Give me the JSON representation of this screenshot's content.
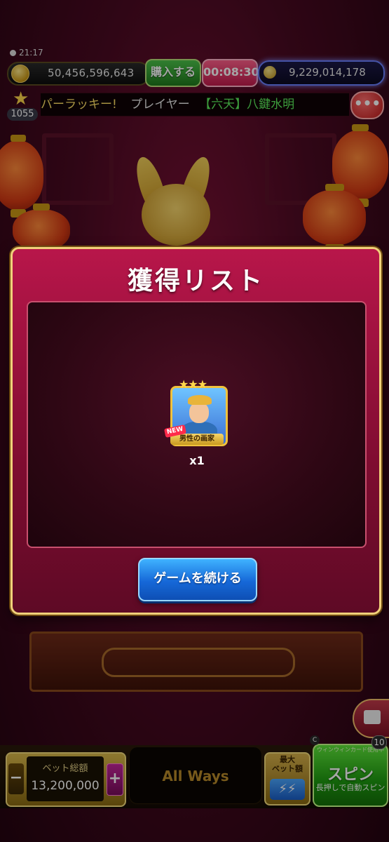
{
  "status": {
    "time": "21:17"
  },
  "hud": {
    "coins": "50,456,596,643",
    "buy_label": "購入する",
    "timer": "00:08:30",
    "gems": "9,229,014,178"
  },
  "level": {
    "number": "1055"
  },
  "marquee": {
    "part1": "パーラッキー!",
    "part2": "プレイヤー",
    "part3": "【六天】八鍵水明"
  },
  "modal": {
    "title": "獲得リスト",
    "item": {
      "stars": "★★★",
      "new_tag": "NEW",
      "name": "男性の画家",
      "quantity": "x1"
    },
    "continue_label": "ゲームを続ける"
  },
  "bottom": {
    "bet_label": "ベット総額",
    "bet_value": "13,200,000",
    "minus": "−",
    "plus": "+",
    "ways_label": "All Ways",
    "maxbet_label": "最大\nベット額",
    "maxbet_icon": "⚡⚡",
    "spin_top_label": "ウィンウィンカード使用中",
    "spin_label": "スピン",
    "spin_sub": "長押しで自動スピン",
    "spin_c": "C",
    "spin_count": "10"
  },
  "menu_icon": "•••"
}
